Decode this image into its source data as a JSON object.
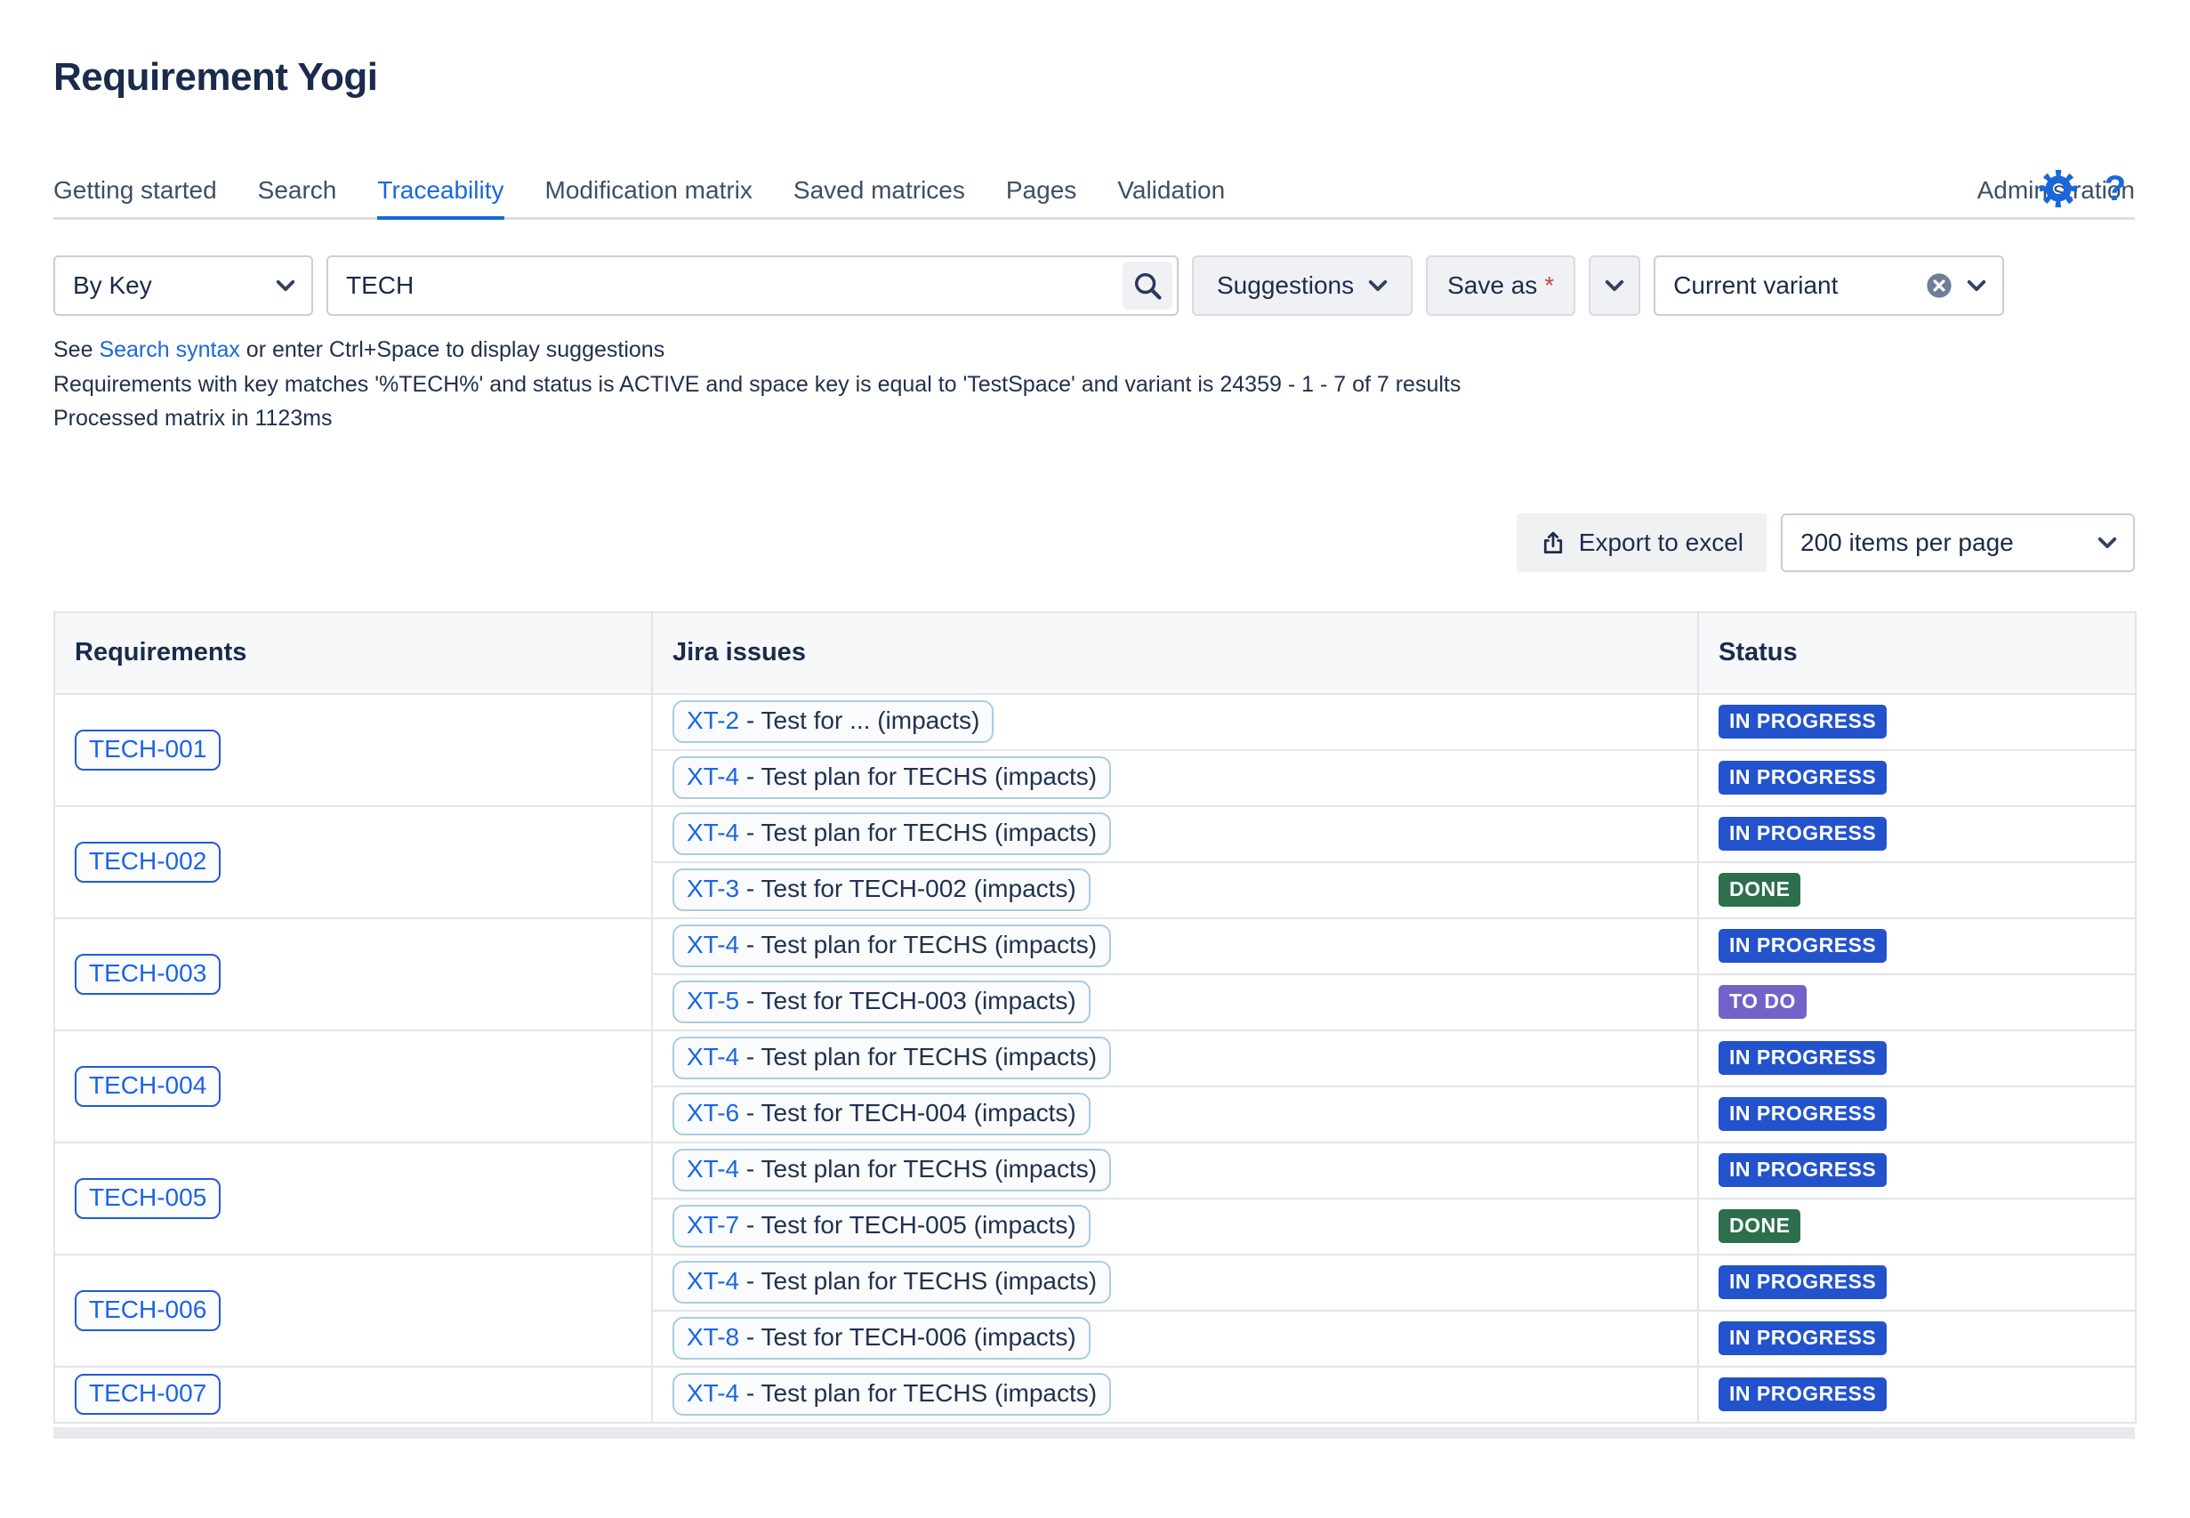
{
  "app": {
    "title": "Requirement Yogi"
  },
  "header_icons": {
    "settings": "gear",
    "help": "?"
  },
  "tabs": {
    "items": [
      "Getting started",
      "Search",
      "Traceability",
      "Modification matrix",
      "Saved matrices",
      "Pages",
      "Validation"
    ],
    "active": "Traceability",
    "right_item": "Administration"
  },
  "search": {
    "scope_select": {
      "value": "By Key"
    },
    "query_input": {
      "value": "TECH"
    },
    "suggestions_button": "Suggestions",
    "save_as_button": "Save as",
    "save_as_required_marker": "*",
    "variant_select": {
      "value": "Current variant"
    }
  },
  "hints": {
    "syntax_prefix": "See ",
    "syntax_link": "Search syntax",
    "syntax_suffix": " or enter Ctrl+Space to display suggestions",
    "result_summary": "Requirements with key matches '%TECH%' and status is ACTIVE and space key is equal to 'TestSpace' and variant is 24359 - 1 - 7 of 7 results",
    "processed": "Processed matrix in 1123ms"
  },
  "toolbar": {
    "export_label": "Export to excel",
    "page_size_value": "200 items per page"
  },
  "table": {
    "columns": [
      "Requirements",
      "Jira issues",
      "Status"
    ],
    "issue_separator": "-",
    "groups": [
      {
        "requirement": "TECH-001",
        "issues": [
          {
            "key": "XT-2",
            "summary": "Test for ... (impacts)",
            "status": "IN PROGRESS",
            "status_type": "inprogress"
          },
          {
            "key": "XT-4",
            "summary": "Test plan for TECHS (impacts)",
            "status": "IN PROGRESS",
            "status_type": "inprogress"
          }
        ]
      },
      {
        "requirement": "TECH-002",
        "issues": [
          {
            "key": "XT-4",
            "summary": "Test plan for TECHS (impacts)",
            "status": "IN PROGRESS",
            "status_type": "inprogress"
          },
          {
            "key": "XT-3",
            "summary": "Test for TECH-002 (impacts)",
            "status": "DONE",
            "status_type": "done"
          }
        ]
      },
      {
        "requirement": "TECH-003",
        "issues": [
          {
            "key": "XT-4",
            "summary": "Test plan for TECHS (impacts)",
            "status": "IN PROGRESS",
            "status_type": "inprogress"
          },
          {
            "key": "XT-5",
            "summary": "Test for TECH-003 (impacts)",
            "status": "TO DO",
            "status_type": "todo"
          }
        ]
      },
      {
        "requirement": "TECH-004",
        "issues": [
          {
            "key": "XT-4",
            "summary": "Test plan for TECHS (impacts)",
            "status": "IN PROGRESS",
            "status_type": "inprogress"
          },
          {
            "key": "XT-6",
            "summary": "Test for TECH-004 (impacts)",
            "status": "IN PROGRESS",
            "status_type": "inprogress"
          }
        ]
      },
      {
        "requirement": "TECH-005",
        "issues": [
          {
            "key": "XT-4",
            "summary": "Test plan for TECHS (impacts)",
            "status": "IN PROGRESS",
            "status_type": "inprogress"
          },
          {
            "key": "XT-7",
            "summary": "Test for TECH-005 (impacts)",
            "status": "DONE",
            "status_type": "done"
          }
        ]
      },
      {
        "requirement": "TECH-006",
        "issues": [
          {
            "key": "XT-4",
            "summary": "Test plan for TECHS (impacts)",
            "status": "IN PROGRESS",
            "status_type": "inprogress"
          },
          {
            "key": "XT-8",
            "summary": "Test for TECH-006 (impacts)",
            "status": "IN PROGRESS",
            "status_type": "inprogress"
          }
        ]
      },
      {
        "requirement": "TECH-007",
        "issues": [
          {
            "key": "XT-4",
            "summary": "Test plan for TECHS (impacts)",
            "status": "IN PROGRESS",
            "status_type": "inprogress"
          }
        ]
      }
    ]
  },
  "colors": {
    "accent_blue": "#1868DB",
    "link_blue": "#1B66DE",
    "badge_inprogress": "#2353CC",
    "badge_done": "#2D6E4D",
    "badge_todo": "#7262C9"
  }
}
